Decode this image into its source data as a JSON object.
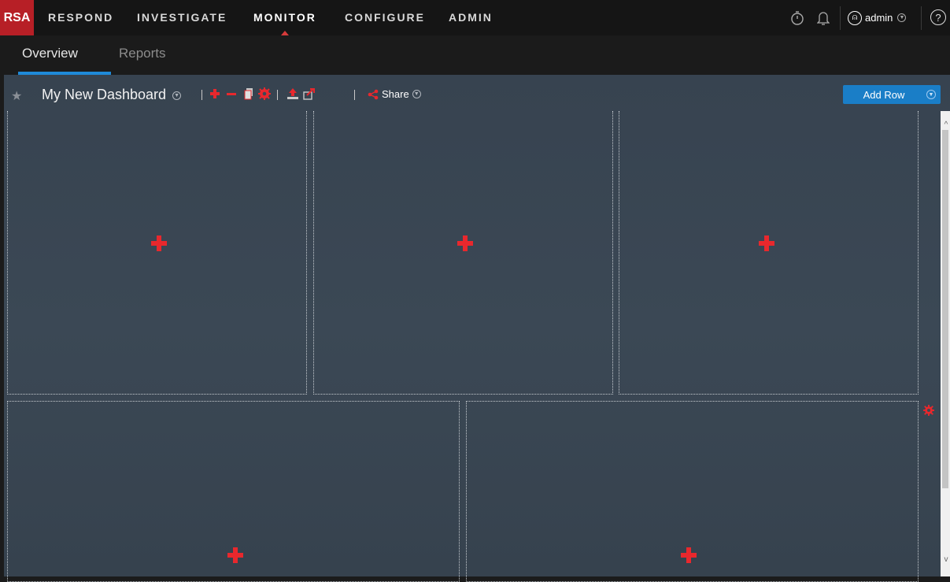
{
  "brand": {
    "logo": "RSA",
    "logo_color": "#b71f26"
  },
  "nav": {
    "items": [
      {
        "label": "RESPOND"
      },
      {
        "label": "INVESTIGATE"
      },
      {
        "label": "MONITOR",
        "active": true
      },
      {
        "label": "CONFIGURE"
      },
      {
        "label": "ADMIN"
      }
    ],
    "right": {
      "timer_icon": "stopwatch-icon",
      "bell_icon": "bell-icon",
      "user_label": "admin",
      "help_label": "?"
    }
  },
  "subnav": {
    "tabs": [
      {
        "label": "Overview",
        "active": true
      },
      {
        "label": "Reports"
      }
    ],
    "accent": "#1f8ad9"
  },
  "dashboard": {
    "title": "My New Dashboard",
    "toolbar_icons": [
      "add-icon",
      "remove-icon",
      "copy-icon",
      "settings-icon",
      "import-icon",
      "export-icon"
    ],
    "share_label": "Share",
    "add_row_label": "Add Row",
    "add_row_color": "#1a7ec7",
    "add_icon_color": "#e8282d"
  }
}
